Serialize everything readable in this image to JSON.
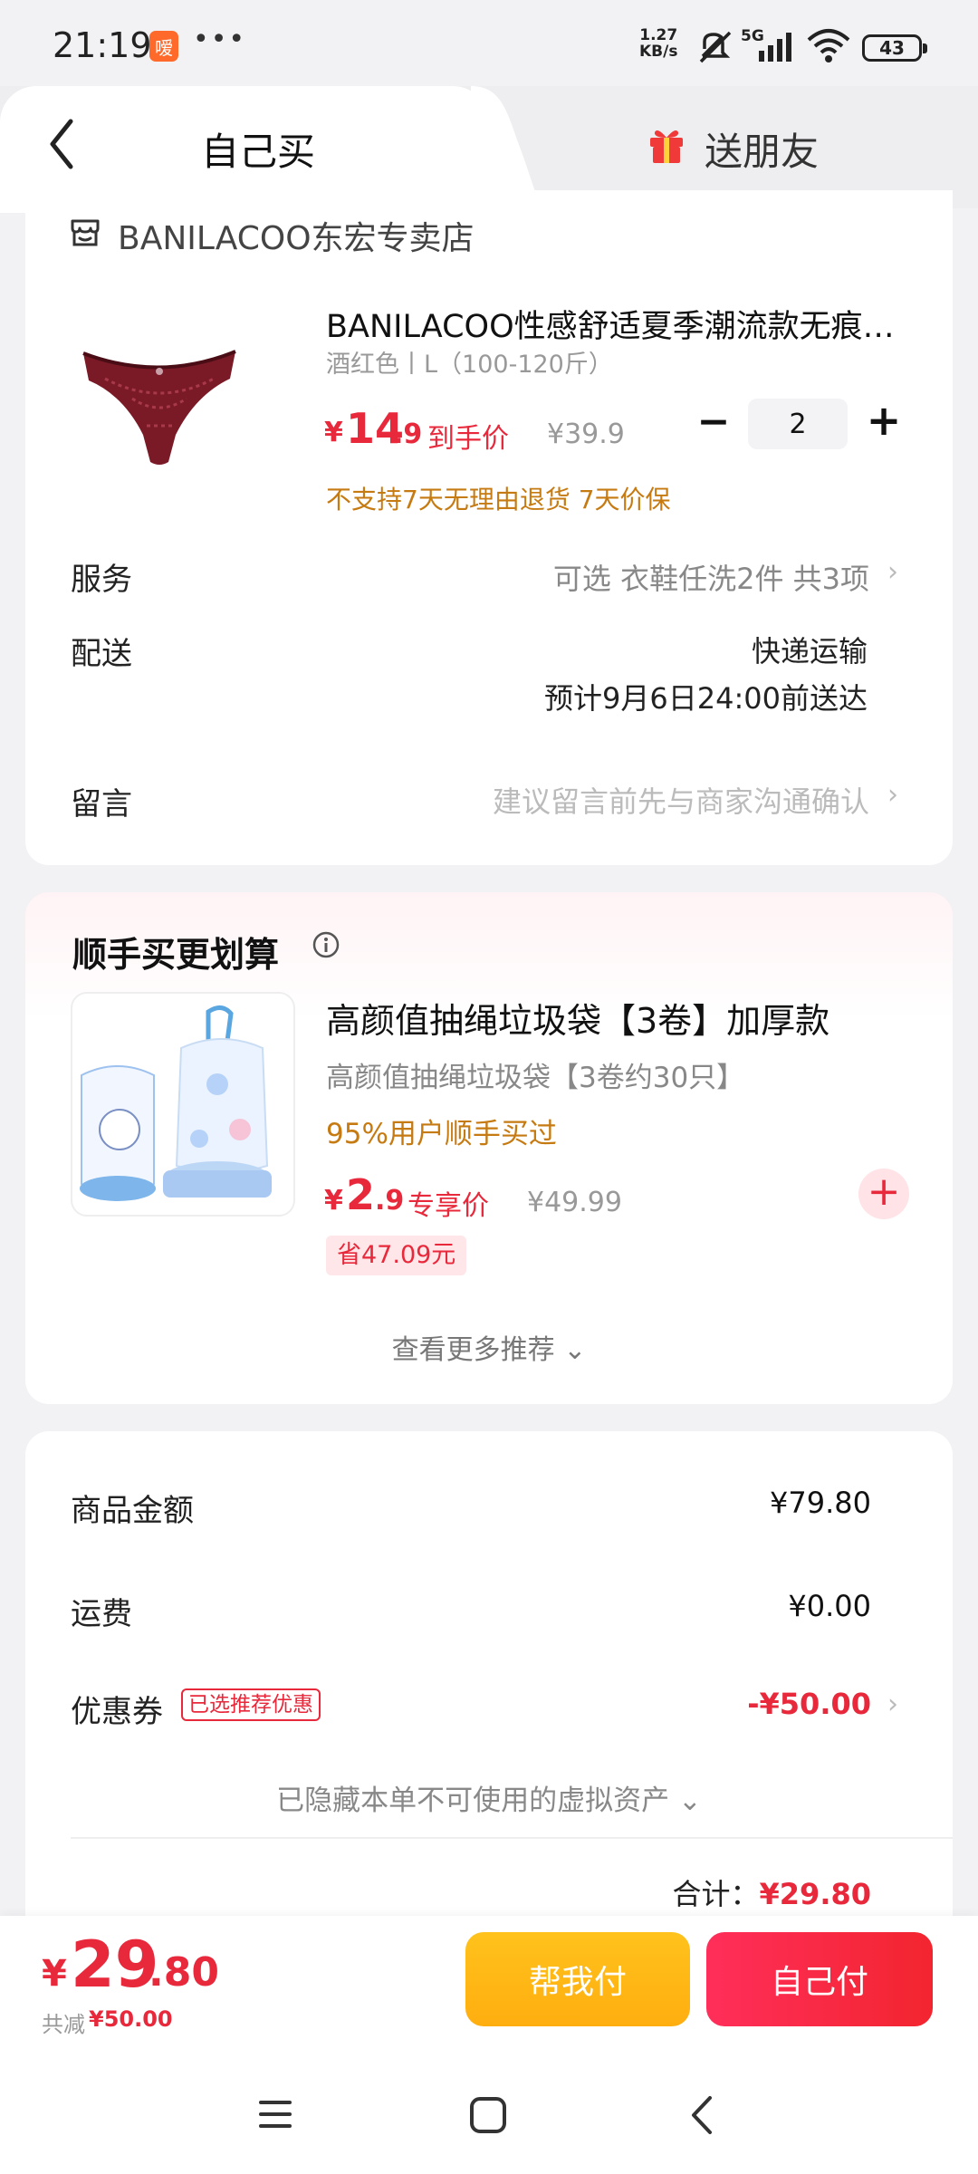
{
  "status_bar": {
    "time": "21:19",
    "app_badge": "嗳",
    "dots": "•••",
    "speed_value": "1.27",
    "speed_unit": "KB/s",
    "network": "5G",
    "battery": "43"
  },
  "tabs": {
    "self_buy": "自己买",
    "send_friend": "送朋友"
  },
  "store": {
    "name": "BANILACOO东宏专卖店"
  },
  "product": {
    "title": "BANILACOO性感舒适夏季潮流款无痕…",
    "variant": "酒红色丨L（100-120斤）",
    "price_symbol": "¥",
    "price_int": "14",
    "price_dec": ".9",
    "price_tag": "到手价",
    "price_original": "¥39.9",
    "quantity": "2",
    "policy": "不支持7天无理由退货  7天价保",
    "image_color": "#7a1a26"
  },
  "order_rows": {
    "service_label": "服务",
    "service_value": "可选  衣鞋任洗2件 共3项",
    "delivery_label": "配送",
    "delivery_method": "快递运输",
    "delivery_eta": "预计9月6日24:00前送达",
    "note_label": "留言",
    "note_value": "建议留言前先与商家沟通确认"
  },
  "addon": {
    "section_title": "顺手买更划算",
    "name": "高颜值抽绳垃圾袋【3卷】加厚款",
    "subtitle": "高颜值抽绳垃圾袋【3卷约30只】",
    "bought": "95%用户顺手买过",
    "price_symbol": "¥",
    "price_int": "2",
    "price_dec": ".9",
    "price_tag": "专享价",
    "price_original": "¥49.99",
    "save_badge": "省47.09元",
    "more": "查看更多推荐 ⌄"
  },
  "summary": {
    "goods_amount_label": "商品金额",
    "goods_amount_value": "¥79.80",
    "shipping_label": "运费",
    "shipping_value": "¥0.00",
    "coupon_label": "优惠券",
    "coupon_badge": "已选推荐优惠",
    "coupon_value": "-¥50.00",
    "hidden_assets": "已隐藏本单不可使用的虚拟资产 ⌄",
    "total_label": "合计：",
    "total_value": "¥29.80"
  },
  "bottom": {
    "price_symbol": "¥",
    "price_int": "29",
    "price_dec": ".80",
    "discount_label": "共减",
    "discount_value": "¥50.00",
    "help_pay": "帮我付",
    "self_pay": "自己付"
  },
  "colors": {
    "accent_red": "#e8283b",
    "accent_orange": "#c67a12",
    "help_pay_yellow": "#ffb914"
  }
}
